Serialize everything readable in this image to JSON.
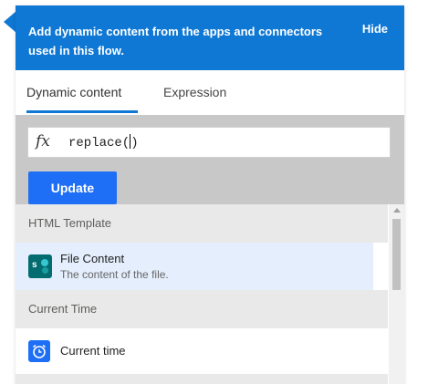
{
  "header": {
    "message": "Add dynamic content from the apps and connectors used in this flow.",
    "hide_label": "Hide"
  },
  "tabs": [
    {
      "label": "Dynamic content",
      "active": true
    },
    {
      "label": "Expression",
      "active": false
    }
  ],
  "editor": {
    "fx_label": "fx",
    "formula_value": "replace(",
    "formula_suffix": ")",
    "update_label": "Update"
  },
  "sections": [
    {
      "title": "HTML Template",
      "items": [
        {
          "title": "File Content",
          "description": "The content of the file.",
          "icon": "sharepoint-icon",
          "selected": true
        }
      ]
    },
    {
      "title": "Current Time",
      "items": [
        {
          "title": "Current time",
          "description": "",
          "icon": "alarm-clock-icon",
          "selected": false
        }
      ]
    }
  ],
  "colors": {
    "accent": "#0f78d4",
    "button": "#1e6ff5",
    "selected_row": "#e4eefc",
    "section_bg": "#e8e9e8"
  }
}
